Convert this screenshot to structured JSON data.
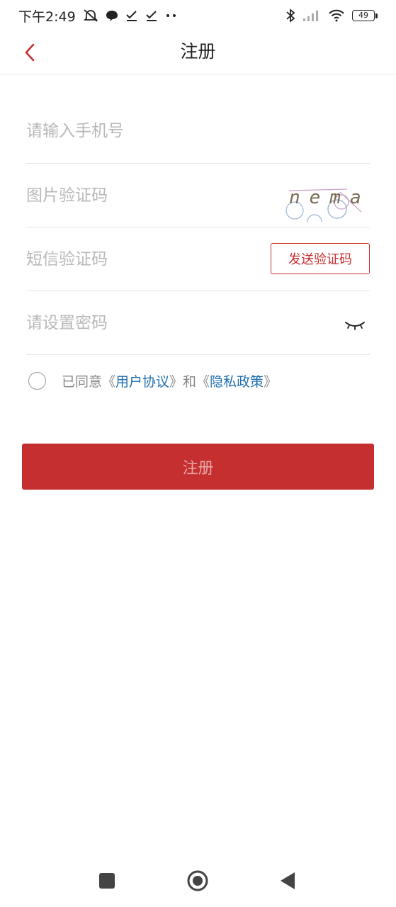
{
  "status_bar": {
    "time": "下午2:49",
    "battery": "49",
    "icons": [
      "mute-icon",
      "chat-bubble-icon",
      "check-icon",
      "check-icon",
      "more-dots-icon",
      "bluetooth-icon",
      "signal-icon",
      "wifi-icon",
      "battery-icon"
    ]
  },
  "header": {
    "title": "注册"
  },
  "form": {
    "phone_placeholder": "请输入手机号",
    "captcha_placeholder": "图片验证码",
    "captcha_text": "nema",
    "sms_placeholder": "短信验证码",
    "send_code_label": "发送验证码",
    "password_placeholder": "请设置密码"
  },
  "agreement": {
    "prefix": "已同意《",
    "user_agreement": "用户协议",
    "middle": "》和《",
    "privacy_policy": "隐私政策",
    "suffix": "》"
  },
  "submit_label": "注册",
  "colors": {
    "accent": "#c62f2f",
    "link": "#1f6fb0",
    "placeholder": "#b8b8b8"
  }
}
